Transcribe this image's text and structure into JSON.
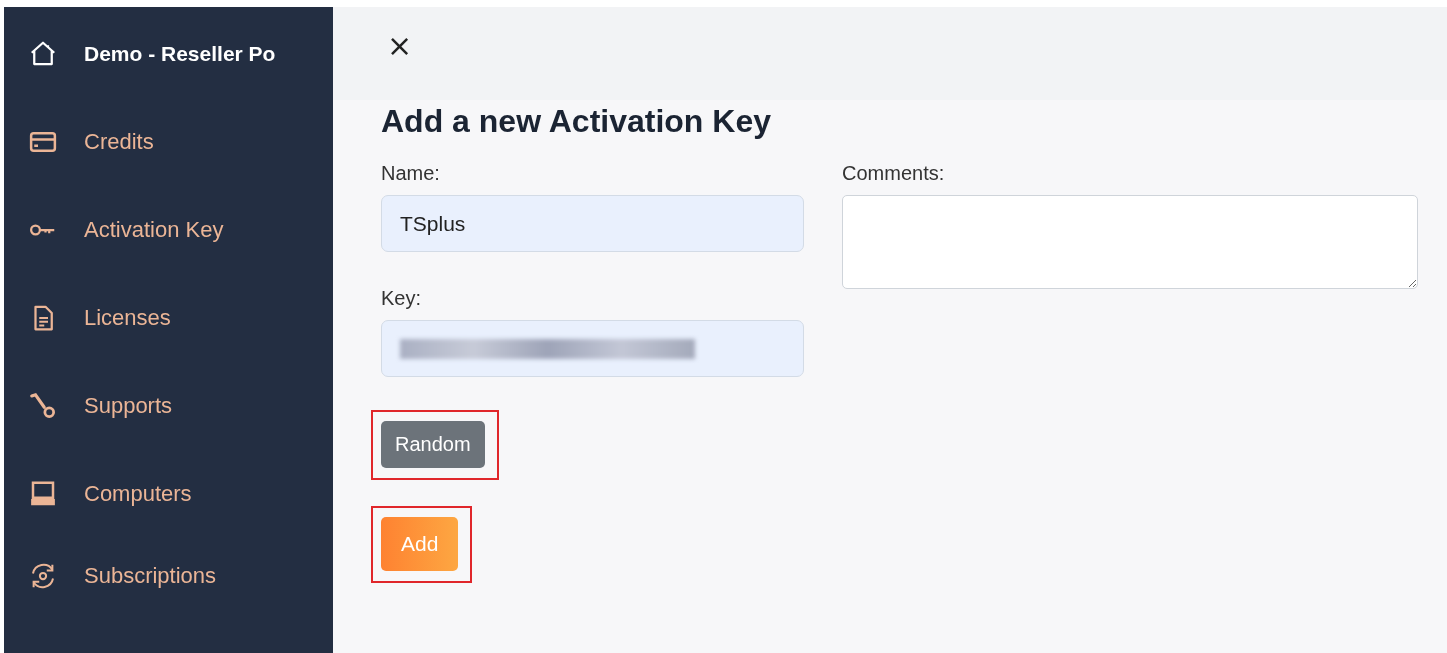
{
  "sidebar": {
    "items": [
      {
        "label": "Demo - Reseller Po",
        "kind": "brand"
      },
      {
        "label": "Credits",
        "kind": "link"
      },
      {
        "label": "Activation Key",
        "kind": "link"
      },
      {
        "label": "Licenses",
        "kind": "link"
      },
      {
        "label": "Supports",
        "kind": "link"
      },
      {
        "label": "Computers",
        "kind": "link"
      },
      {
        "label": "Subscriptions",
        "kind": "link"
      }
    ]
  },
  "dialog": {
    "close": "×",
    "title": "Add a new Activation Key",
    "name_field": {
      "label": "Name:",
      "value": "TSplus"
    },
    "key_field": {
      "label": "Key:",
      "redacted": true
    },
    "comments_field": {
      "label": "Comments:"
    },
    "buttons": [
      {
        "label": "Random",
        "kind": "secondary",
        "highlighted": true
      },
      {
        "label": "Add",
        "kind": "primary",
        "highlighted": true
      }
    ]
  }
}
